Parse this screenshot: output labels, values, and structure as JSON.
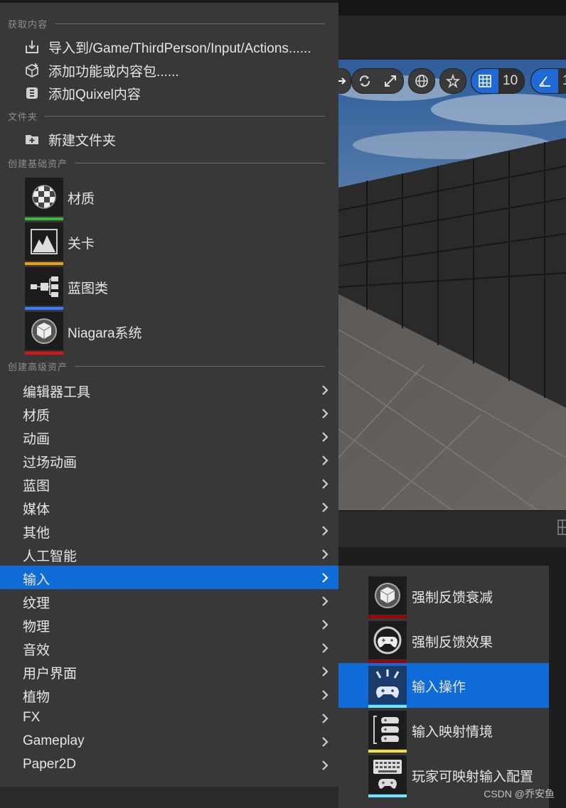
{
  "toolbar": {
    "grid_value": "10",
    "angle_value": "1"
  },
  "menu": {
    "sections": {
      "get_content": "获取内容",
      "folder": "文件夹",
      "basic_assets": "创建基础资产",
      "advanced_assets": "创建高级资产"
    },
    "commands": [
      {
        "label": "导入到/Game/ThirdPerson/Input/Actions......",
        "icon": "import-icon"
      },
      {
        "label": "添加功能或内容包......",
        "icon": "add-feature-pack-icon"
      },
      {
        "label": "添加Quixel内容",
        "icon": "quixel-icon"
      }
    ],
    "new_folder": {
      "label": "新建文件夹",
      "icon": "new-folder-icon"
    },
    "basic_assets": [
      {
        "label": "材质",
        "icon": "material-icon",
        "color": "#3dba3d"
      },
      {
        "label": "关卡",
        "icon": "level-icon",
        "color": "#f0a000"
      },
      {
        "label": "蓝图类",
        "icon": "blueprint-icon",
        "color": "#3a7bff"
      },
      {
        "label": "Niagara系统",
        "icon": "niagara-icon",
        "color": "#e01010"
      }
    ],
    "advanced": [
      {
        "label": "编辑器工具"
      },
      {
        "label": "材质"
      },
      {
        "label": "动画"
      },
      {
        "label": "过场动画"
      },
      {
        "label": "蓝图"
      },
      {
        "label": "媒体"
      },
      {
        "label": "其他"
      },
      {
        "label": "人工智能"
      },
      {
        "label": "输入"
      },
      {
        "label": "纹理"
      },
      {
        "label": "物理"
      },
      {
        "label": "音效"
      },
      {
        "label": "用户界面"
      },
      {
        "label": "植物"
      },
      {
        "label": "FX"
      },
      {
        "label": "Gameplay"
      },
      {
        "label": "Paper2D"
      }
    ],
    "active_category": "输入"
  },
  "submenu": {
    "items": [
      {
        "label": "强制反馈衰减",
        "icon": "force-feedback-attenuation-icon",
        "color": "#a00000"
      },
      {
        "label": "强制反馈效果",
        "icon": "force-feedback-effect-icon",
        "color": "#a00000"
      },
      {
        "label": "输入操作",
        "icon": "input-action-icon",
        "color": "#6ee6ff"
      },
      {
        "label": "输入映射情境",
        "icon": "input-mapping-context-icon",
        "color": "#f0e040"
      },
      {
        "label": "玩家可映射输入配置",
        "icon": "player-mappable-input-config-icon",
        "color": "#6ee6ff"
      }
    ],
    "active": "输入操作"
  },
  "watermark": "CSDN @乔安鱼"
}
